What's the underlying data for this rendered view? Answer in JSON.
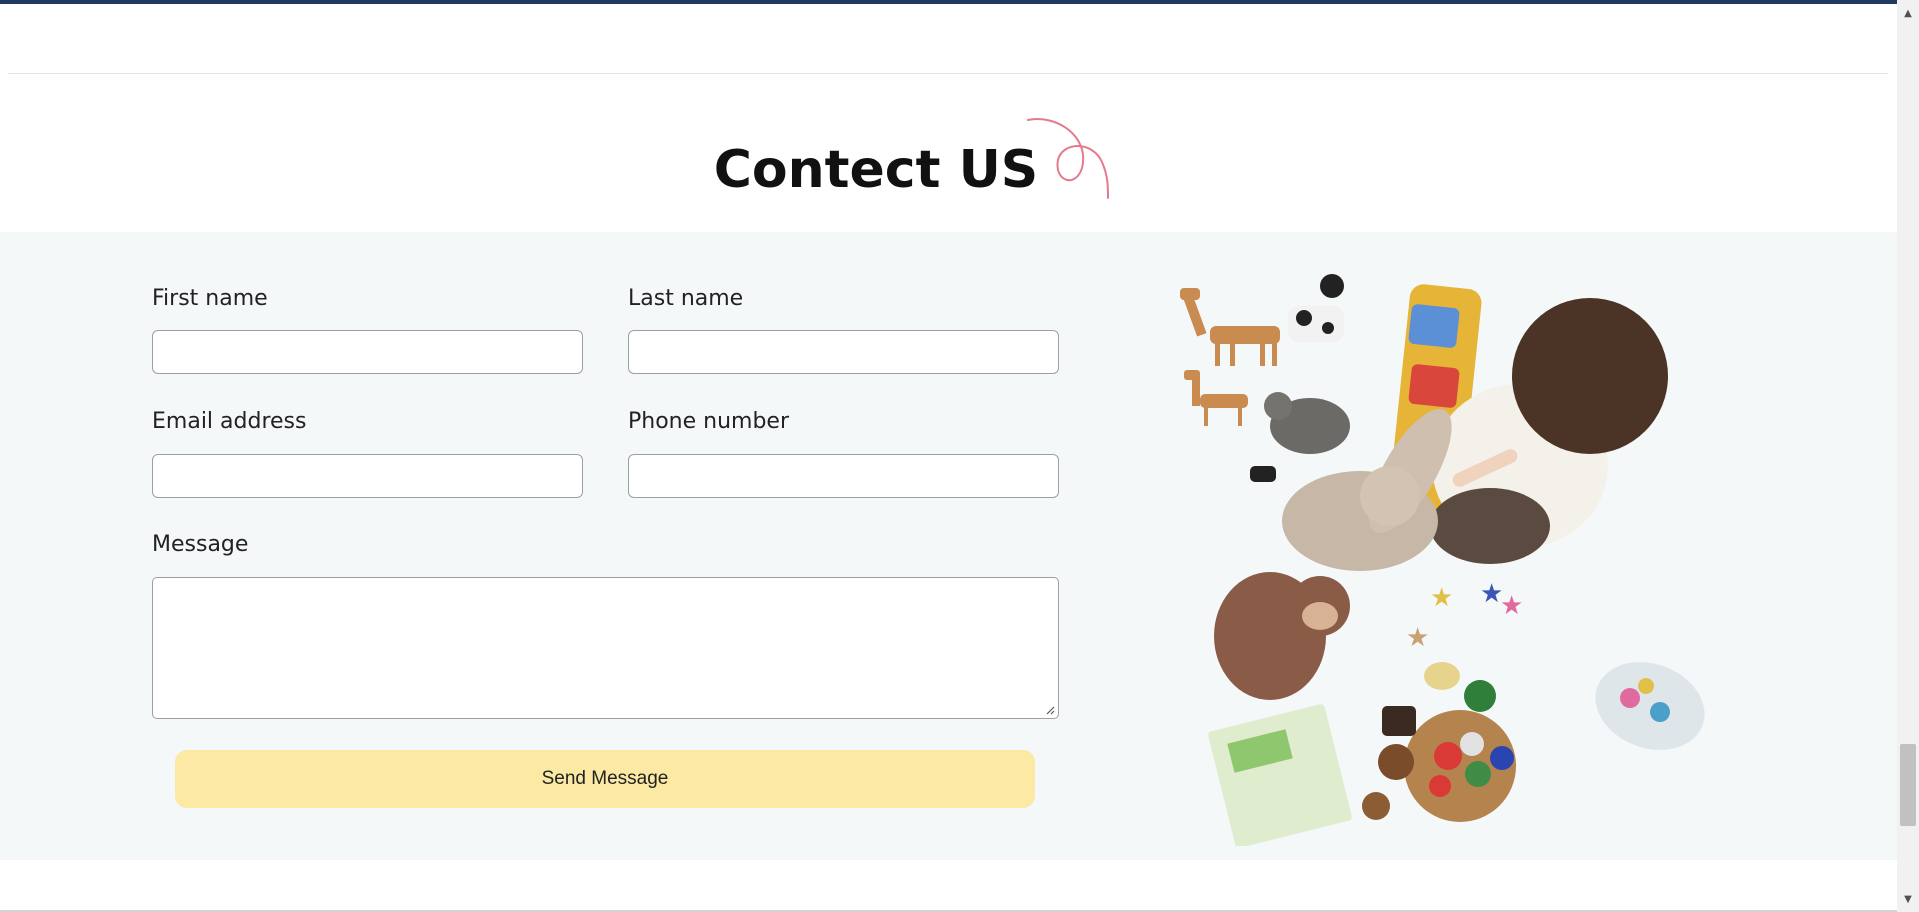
{
  "heading": {
    "title": "Contect US"
  },
  "form": {
    "first_name_label": "First name",
    "last_name_label": "Last name",
    "email_label": "Email address",
    "phone_label": "Phone number",
    "message_label": "Message",
    "first_name_value": "",
    "last_name_value": "",
    "email_value": "",
    "phone_value": "",
    "message_value": "",
    "submit_label": "Send Message"
  },
  "colors": {
    "section_background": "#f4f8f9",
    "button_background": "#fbe9a4",
    "accent_swirl": "#e57a8c",
    "top_bar": "#1f3a5f"
  },
  "icons": {
    "decoration": "swirl-icon",
    "scroll_up": "chevron-up-icon",
    "scroll_down": "chevron-down-icon"
  }
}
